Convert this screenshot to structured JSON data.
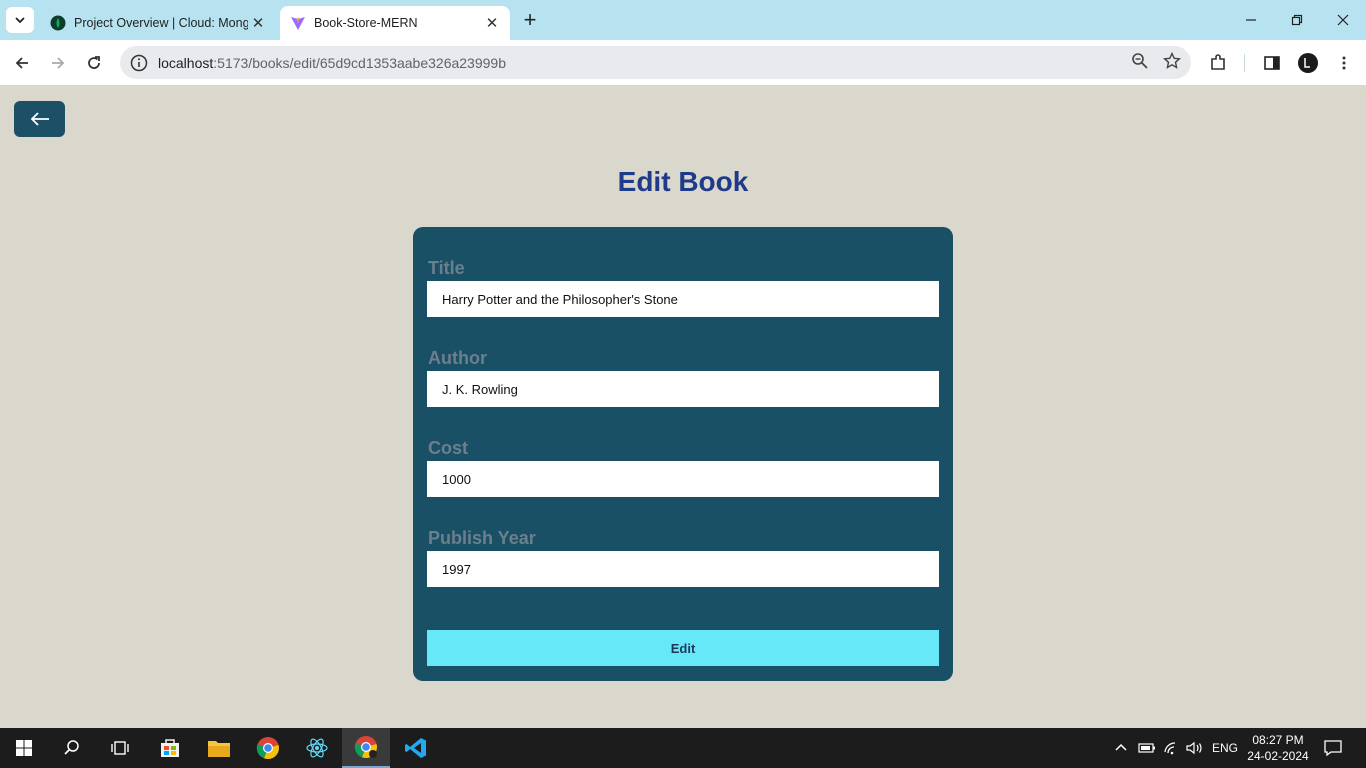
{
  "browser": {
    "tabs": [
      {
        "title": "Project Overview | Cloud: Mong",
        "active": false
      },
      {
        "title": "Book-Store-MERN",
        "active": true
      }
    ],
    "url_host": "localhost",
    "url_path": ":5173/books/edit/65d9cd1353aabe326a23999b"
  },
  "page": {
    "title": "Edit Book",
    "back_icon": "arrow-left-icon",
    "fields": [
      {
        "label": "Title",
        "value": "Harry Potter and the Philosopher's Stone"
      },
      {
        "label": "Author",
        "value": "J. K. Rowling"
      },
      {
        "label": "Cost",
        "value": "1000"
      },
      {
        "label": "Publish Year",
        "value": "1997"
      }
    ],
    "submit_label": "Edit",
    "colors": {
      "background": "#dad7cd",
      "card": "#1a5066",
      "title": "#1e3a8a",
      "button": "#67e8f9"
    }
  },
  "taskbar": {
    "language": "ENG",
    "time": "08:27 PM",
    "date": "24-02-2024"
  }
}
